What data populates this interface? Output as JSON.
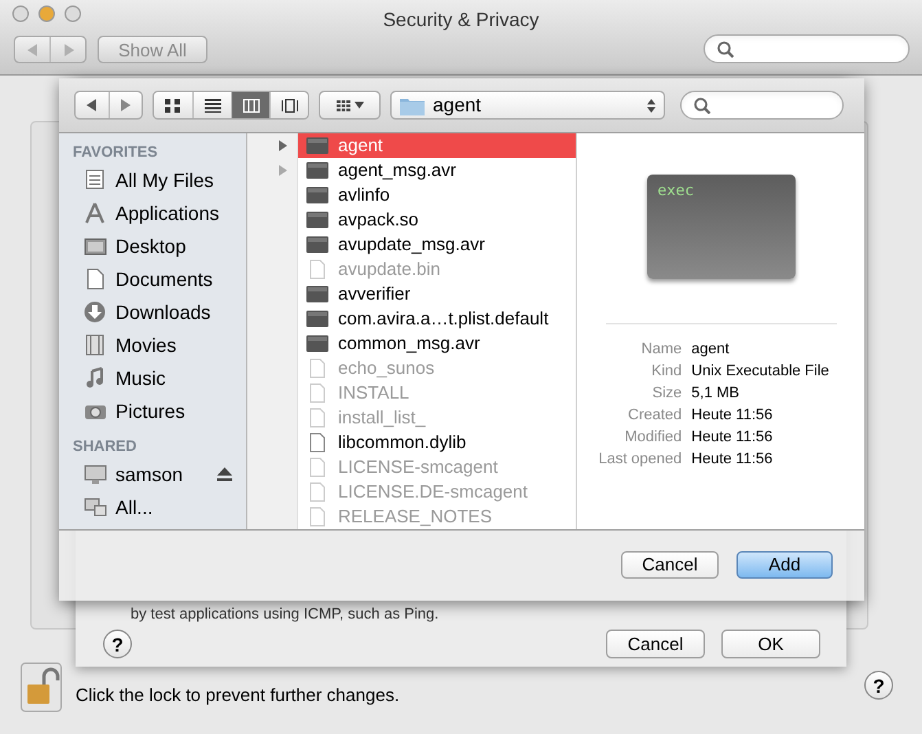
{
  "window": {
    "title": "Security & Privacy",
    "toolbar": {
      "show_all": "Show All"
    }
  },
  "firewall_sheet": {
    "stealth": {
      "description_2": "by test applications using ICMP, such as Ping."
    },
    "help": "?",
    "buttons": [
      {
        "label": "Cancel",
        "default": false
      },
      {
        "label": "OK",
        "default": false
      }
    ]
  },
  "file_dialog": {
    "view_modes": [
      {
        "kind": "icons",
        "selected": false
      },
      {
        "kind": "list",
        "selected": false
      },
      {
        "kind": "columns",
        "selected": true
      },
      {
        "kind": "coverflow",
        "selected": false
      }
    ],
    "location": "agent",
    "sidebar": [
      {
        "heading": "FAVORITES",
        "items": [
          {
            "label": "All My Files",
            "kind": "files"
          },
          {
            "label": "Applications",
            "kind": "apps"
          },
          {
            "label": "Desktop",
            "kind": "desktop"
          },
          {
            "label": "Documents",
            "kind": "documents"
          },
          {
            "label": "Downloads",
            "kind": "downloads"
          },
          {
            "label": "Movies",
            "kind": "movies"
          },
          {
            "label": "Music",
            "kind": "music"
          },
          {
            "label": "Pictures",
            "kind": "pictures"
          }
        ]
      },
      {
        "heading": "SHARED",
        "items": [
          {
            "label": "samson",
            "kind": "computer",
            "ejectable": true
          },
          {
            "label": "All...",
            "kind": "network"
          }
        ]
      }
    ],
    "files": [
      {
        "name": "agent",
        "kind": "exec",
        "disclosure": true,
        "disabled": false,
        "selected": true
      },
      {
        "name": "agent_msg.avr",
        "kind": "exec",
        "disclosure": true,
        "disabled": false,
        "selected": false
      },
      {
        "name": "avlinfo",
        "kind": "exec",
        "disclosure": false,
        "disabled": false,
        "selected": false
      },
      {
        "name": "avpack.so",
        "kind": "exec",
        "disclosure": false,
        "disabled": false,
        "selected": false
      },
      {
        "name": "avupdate_msg.avr",
        "kind": "exec",
        "disclosure": false,
        "disabled": false,
        "selected": false
      },
      {
        "name": "avupdate.bin",
        "kind": "document",
        "disclosure": false,
        "disabled": true,
        "selected": false
      },
      {
        "name": "avverifier",
        "kind": "exec",
        "disclosure": false,
        "disabled": false,
        "selected": false
      },
      {
        "name": "com.avira.a…t.plist.default",
        "kind": "exec",
        "disclosure": false,
        "disabled": false,
        "selected": false
      },
      {
        "name": "common_msg.avr",
        "kind": "exec",
        "disclosure": false,
        "disabled": false,
        "selected": false
      },
      {
        "name": "echo_sunos",
        "kind": "document",
        "disclosure": false,
        "disabled": true,
        "selected": false
      },
      {
        "name": "INSTALL",
        "kind": "document",
        "disclosure": false,
        "disabled": true,
        "selected": false
      },
      {
        "name": "install_list_",
        "kind": "document",
        "disclosure": false,
        "disabled": true,
        "selected": false
      },
      {
        "name": "libcommon.dylib",
        "kind": "document",
        "disclosure": false,
        "disabled": false,
        "selected": false
      },
      {
        "name": "LICENSE-smcagent",
        "kind": "document",
        "disclosure": false,
        "disabled": true,
        "selected": false
      },
      {
        "name": "LICENSE.DE-smcagent",
        "kind": "document",
        "disclosure": false,
        "disabled": true,
        "selected": false
      },
      {
        "name": "RELEASE_NOTES",
        "kind": "document",
        "disclosure": false,
        "disabled": true,
        "selected": false
      }
    ],
    "preview": {
      "icon_label": "exec",
      "info": [
        {
          "label": "Name",
          "value": "agent"
        },
        {
          "label": "Kind",
          "value": "Unix Executable File"
        },
        {
          "label": "Size",
          "value": "5,1 MB"
        },
        {
          "label": "Created",
          "value": "Heute 11:56"
        },
        {
          "label": "Modified",
          "value": "Heute 11:56"
        },
        {
          "label": "Last opened",
          "value": "Heute 11:56"
        }
      ]
    },
    "buttons": [
      {
        "label": "Cancel",
        "default": false
      },
      {
        "label": "Add",
        "default": true
      }
    ]
  },
  "footer": {
    "lock_text": "Click the lock to prevent further changes.",
    "help": "?"
  }
}
